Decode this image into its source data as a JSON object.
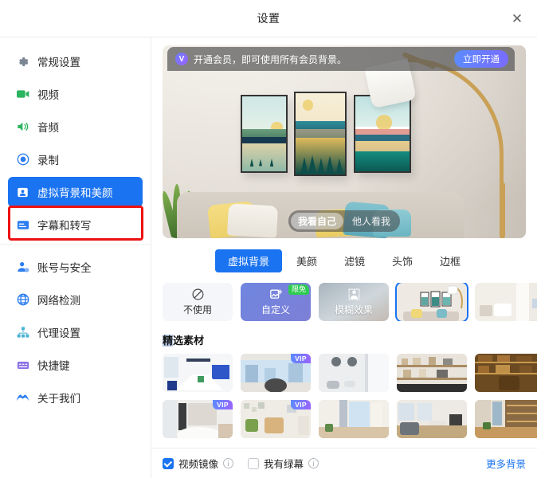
{
  "window": {
    "title": "设置",
    "close_label": "✕"
  },
  "sidebar": {
    "groups": [
      {
        "items": [
          {
            "label": "常规设置",
            "icon": "gear-icon",
            "active": false
          },
          {
            "label": "视频",
            "icon": "camera-icon",
            "active": false
          },
          {
            "label": "音频",
            "icon": "speaker-icon",
            "active": false
          },
          {
            "label": "录制",
            "icon": "record-icon",
            "active": false
          },
          {
            "label": "虚拟背景和美颜",
            "icon": "person-card-icon",
            "active": true
          },
          {
            "label": "字幕和转写",
            "icon": "caption-icon",
            "active": false
          }
        ]
      },
      {
        "items": [
          {
            "label": "账号与安全",
            "icon": "account-security-icon",
            "active": false
          },
          {
            "label": "网络检测",
            "icon": "globe-icon",
            "active": false
          },
          {
            "label": "代理设置",
            "icon": "proxy-icon",
            "active": false
          },
          {
            "label": "快捷键",
            "icon": "keyboard-icon",
            "active": false
          },
          {
            "label": "关于我们",
            "icon": "about-icon",
            "active": false
          }
        ]
      }
    ]
  },
  "banner": {
    "badge": "V",
    "text": "开通会员，即可使用所有会员背景。",
    "button": "立即开通"
  },
  "preview": {
    "view_toggle": [
      {
        "label": "我看自己",
        "selected": true
      },
      {
        "label": "他人看我",
        "selected": false
      }
    ]
  },
  "tabs": [
    {
      "label": "虚拟背景",
      "active": true
    },
    {
      "label": "美颜",
      "active": false
    },
    {
      "label": "滤镜",
      "active": false
    },
    {
      "label": "头饰",
      "active": false
    },
    {
      "label": "边框",
      "active": false
    }
  ],
  "options": [
    {
      "label": "不使用",
      "kind": "none",
      "icon": "no-entry-icon",
      "selected": false,
      "badge": ""
    },
    {
      "label": "自定义",
      "kind": "custom",
      "icon": "add-image-icon",
      "selected": false,
      "badge": "限免"
    },
    {
      "label": "模糊效果",
      "kind": "blur",
      "icon": "blur-person-icon",
      "selected": false,
      "badge": ""
    },
    {
      "label": "",
      "kind": "thumb",
      "icon": "living-room-thumb",
      "selected": true,
      "badge": ""
    },
    {
      "label": "",
      "kind": "thumb",
      "icon": "bedroom-thumb",
      "selected": false,
      "badge": ""
    }
  ],
  "featured": {
    "title_highlight": "精",
    "title_rest": "选素材",
    "tiles": [
      {
        "name": "meeting-room",
        "vip": false
      },
      {
        "name": "city-office",
        "vip": true
      },
      {
        "name": "bright-lounge",
        "vip": false
      },
      {
        "name": "shelf-office",
        "vip": false
      },
      {
        "name": "wood-library",
        "vip": false
      },
      {
        "name": "white-table-room",
        "vip": true
      },
      {
        "name": "green-sofa-room",
        "vip": true
      },
      {
        "name": "curtain-window",
        "vip": false
      },
      {
        "name": "loft-living",
        "vip": false
      },
      {
        "name": "cafe-bar",
        "vip": false
      }
    ],
    "vip_label": "VIP"
  },
  "bottom": {
    "mirror": {
      "label": "视频镜像",
      "checked": true,
      "info": "i"
    },
    "greenscreen": {
      "label": "我有绿幕",
      "checked": false,
      "info": "i"
    },
    "more_link": "更多背景"
  },
  "colors": {
    "accent": "#1a73f0",
    "highlight_box": "#ee1111",
    "vip_gradient_start": "#5b8cff",
    "vip_gradient_end": "#9a63ff",
    "free_badge": "#2ecb52"
  }
}
